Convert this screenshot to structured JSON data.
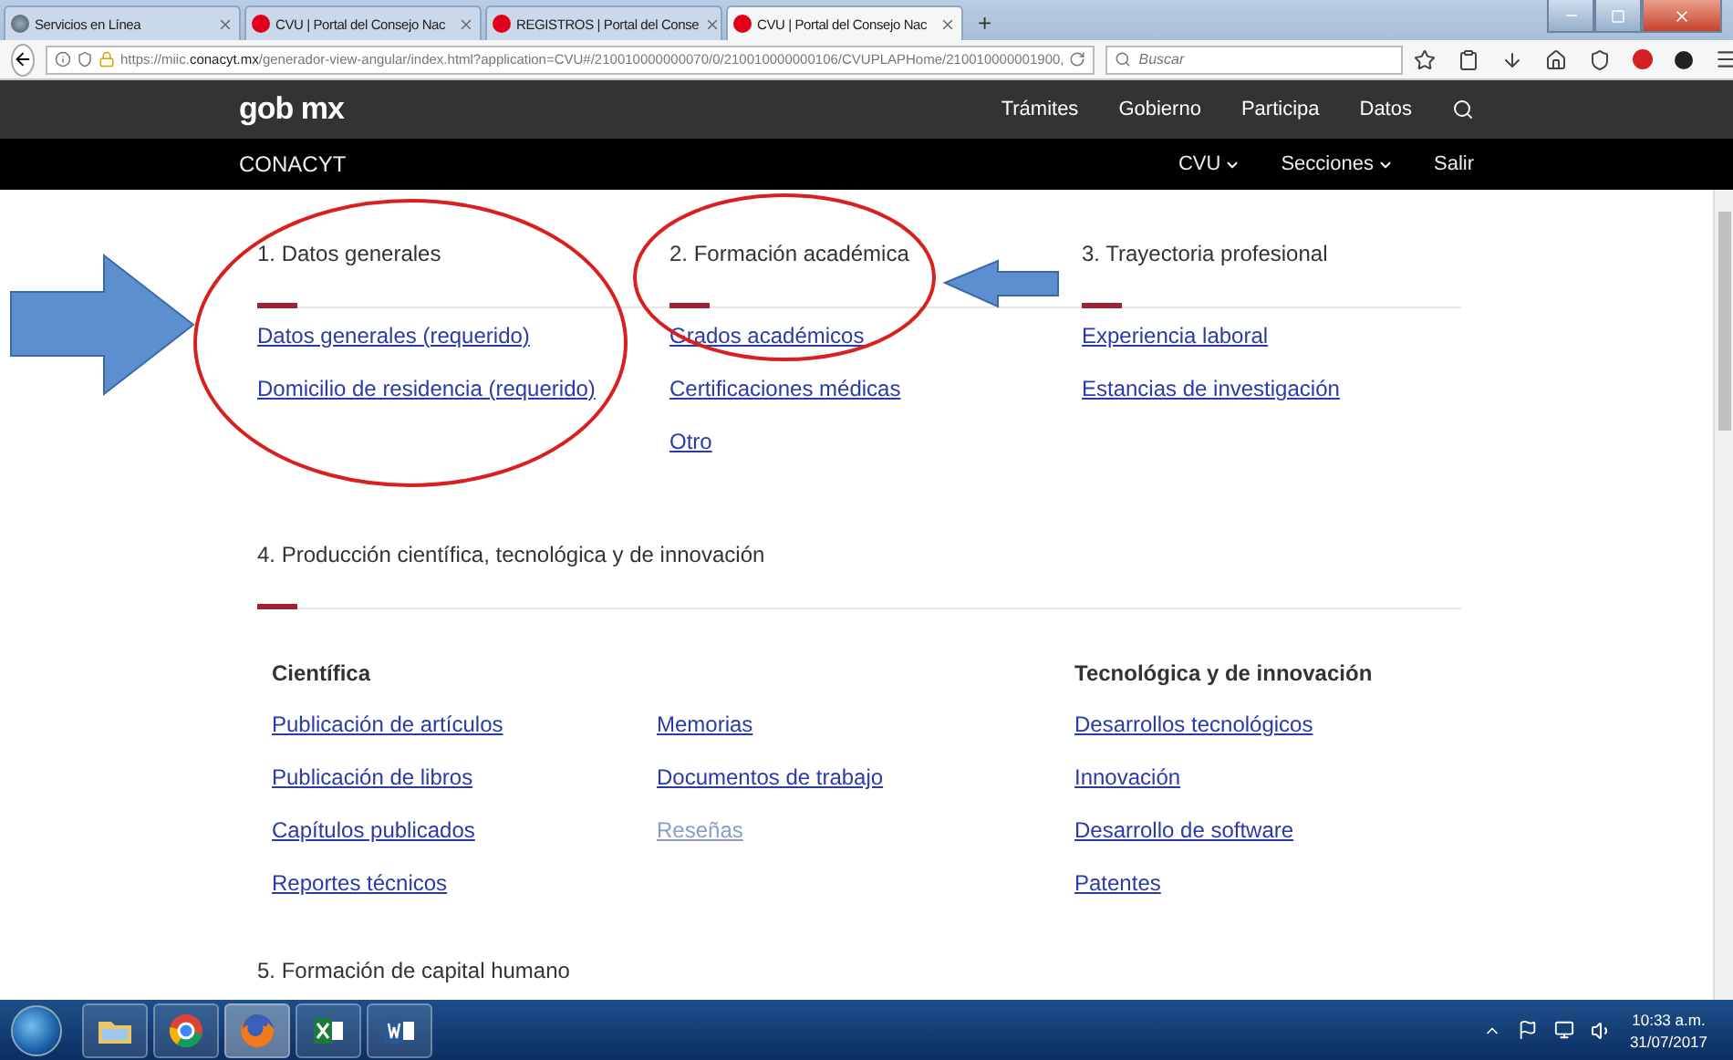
{
  "browser": {
    "tabs": [
      {
        "title": "Servicios en Línea",
        "selected": false,
        "kind": "globe"
      },
      {
        "title": "CVU | Portal del Consejo Nac",
        "selected": false,
        "kind": "dot"
      },
      {
        "title": "REGISTROS | Portal del Conse",
        "selected": false,
        "kind": "dot"
      },
      {
        "title": "CVU | Portal del Consejo Nac",
        "selected": true,
        "kind": "dot"
      }
    ],
    "new_tab": "+",
    "url": "https://miic.**conacyt.mx**/generador-view-angular/index.html?application=CVU#/210010000000070/0/210010000000106/CVUPLAPHome/210010000001900,",
    "search": {
      "placeholder": "Buscar"
    }
  },
  "header": {
    "logo": "gob mx",
    "nav": [
      "Trámites",
      "Gobierno",
      "Participa",
      "Datos"
    ]
  },
  "subheader": {
    "title": "CONACYT",
    "menu": [
      {
        "label": "CVU",
        "dropdown": true
      },
      {
        "label": "Secciones",
        "dropdown": true
      },
      {
        "label": "Salir",
        "dropdown": false
      }
    ]
  },
  "top_sections": [
    {
      "title": "1. Datos generales",
      "links": [
        {
          "label": "Datos generales (requerido)",
          "disabled": false
        },
        {
          "label": "Domicilio de residencia (requerido)",
          "disabled": false
        }
      ]
    },
    {
      "title": "2. Formación académica",
      "links": [
        {
          "label": "Grados académicos",
          "disabled": false
        },
        {
          "label": "Certificaciones médicas",
          "disabled": false
        },
        {
          "label": "Otro",
          "disabled": false
        }
      ]
    },
    {
      "title": "3. Trayectoria profesional",
      "links": [
        {
          "label": "Experiencia laboral",
          "disabled": false
        },
        {
          "label": "Estancias de investigación",
          "disabled": false
        }
      ]
    }
  ],
  "production": {
    "title": "4. Producción científica, tecnológica y de innovación",
    "groups": [
      {
        "heading": "Científica",
        "links": [
          {
            "label": "Publicación de artículos",
            "disabled": false
          },
          {
            "label": "Publicación de libros",
            "disabled": false
          },
          {
            "label": "Capítulos publicados",
            "disabled": false
          },
          {
            "label": "Reportes técnicos",
            "disabled": false
          }
        ]
      },
      {
        "links": [
          {
            "label": "Memorias",
            "disabled": false
          },
          {
            "label": "Documentos de trabajo",
            "disabled": false
          },
          {
            "label": "Reseñas",
            "disabled": true
          }
        ]
      },
      {
        "heading": "Tecnológica y de innovación",
        "links": [
          {
            "label": "Desarrollos tecnológicos",
            "disabled": false
          },
          {
            "label": "Innovación",
            "disabled": false
          },
          {
            "label": "Desarrollo de software",
            "disabled": false
          },
          {
            "label": "Patentes",
            "disabled": false
          }
        ]
      }
    ]
  },
  "next_section": {
    "title": "5. Formación de capital humano"
  },
  "taskbar": {
    "apps": [
      {
        "kind": "folder",
        "active": false
      },
      {
        "kind": "chrome",
        "active": false
      },
      {
        "kind": "firefox",
        "active": true
      },
      {
        "kind": "excel",
        "active": false
      },
      {
        "kind": "word",
        "active": false
      }
    ],
    "time": "10:33 a.m.",
    "date": "31/07/2017"
  }
}
